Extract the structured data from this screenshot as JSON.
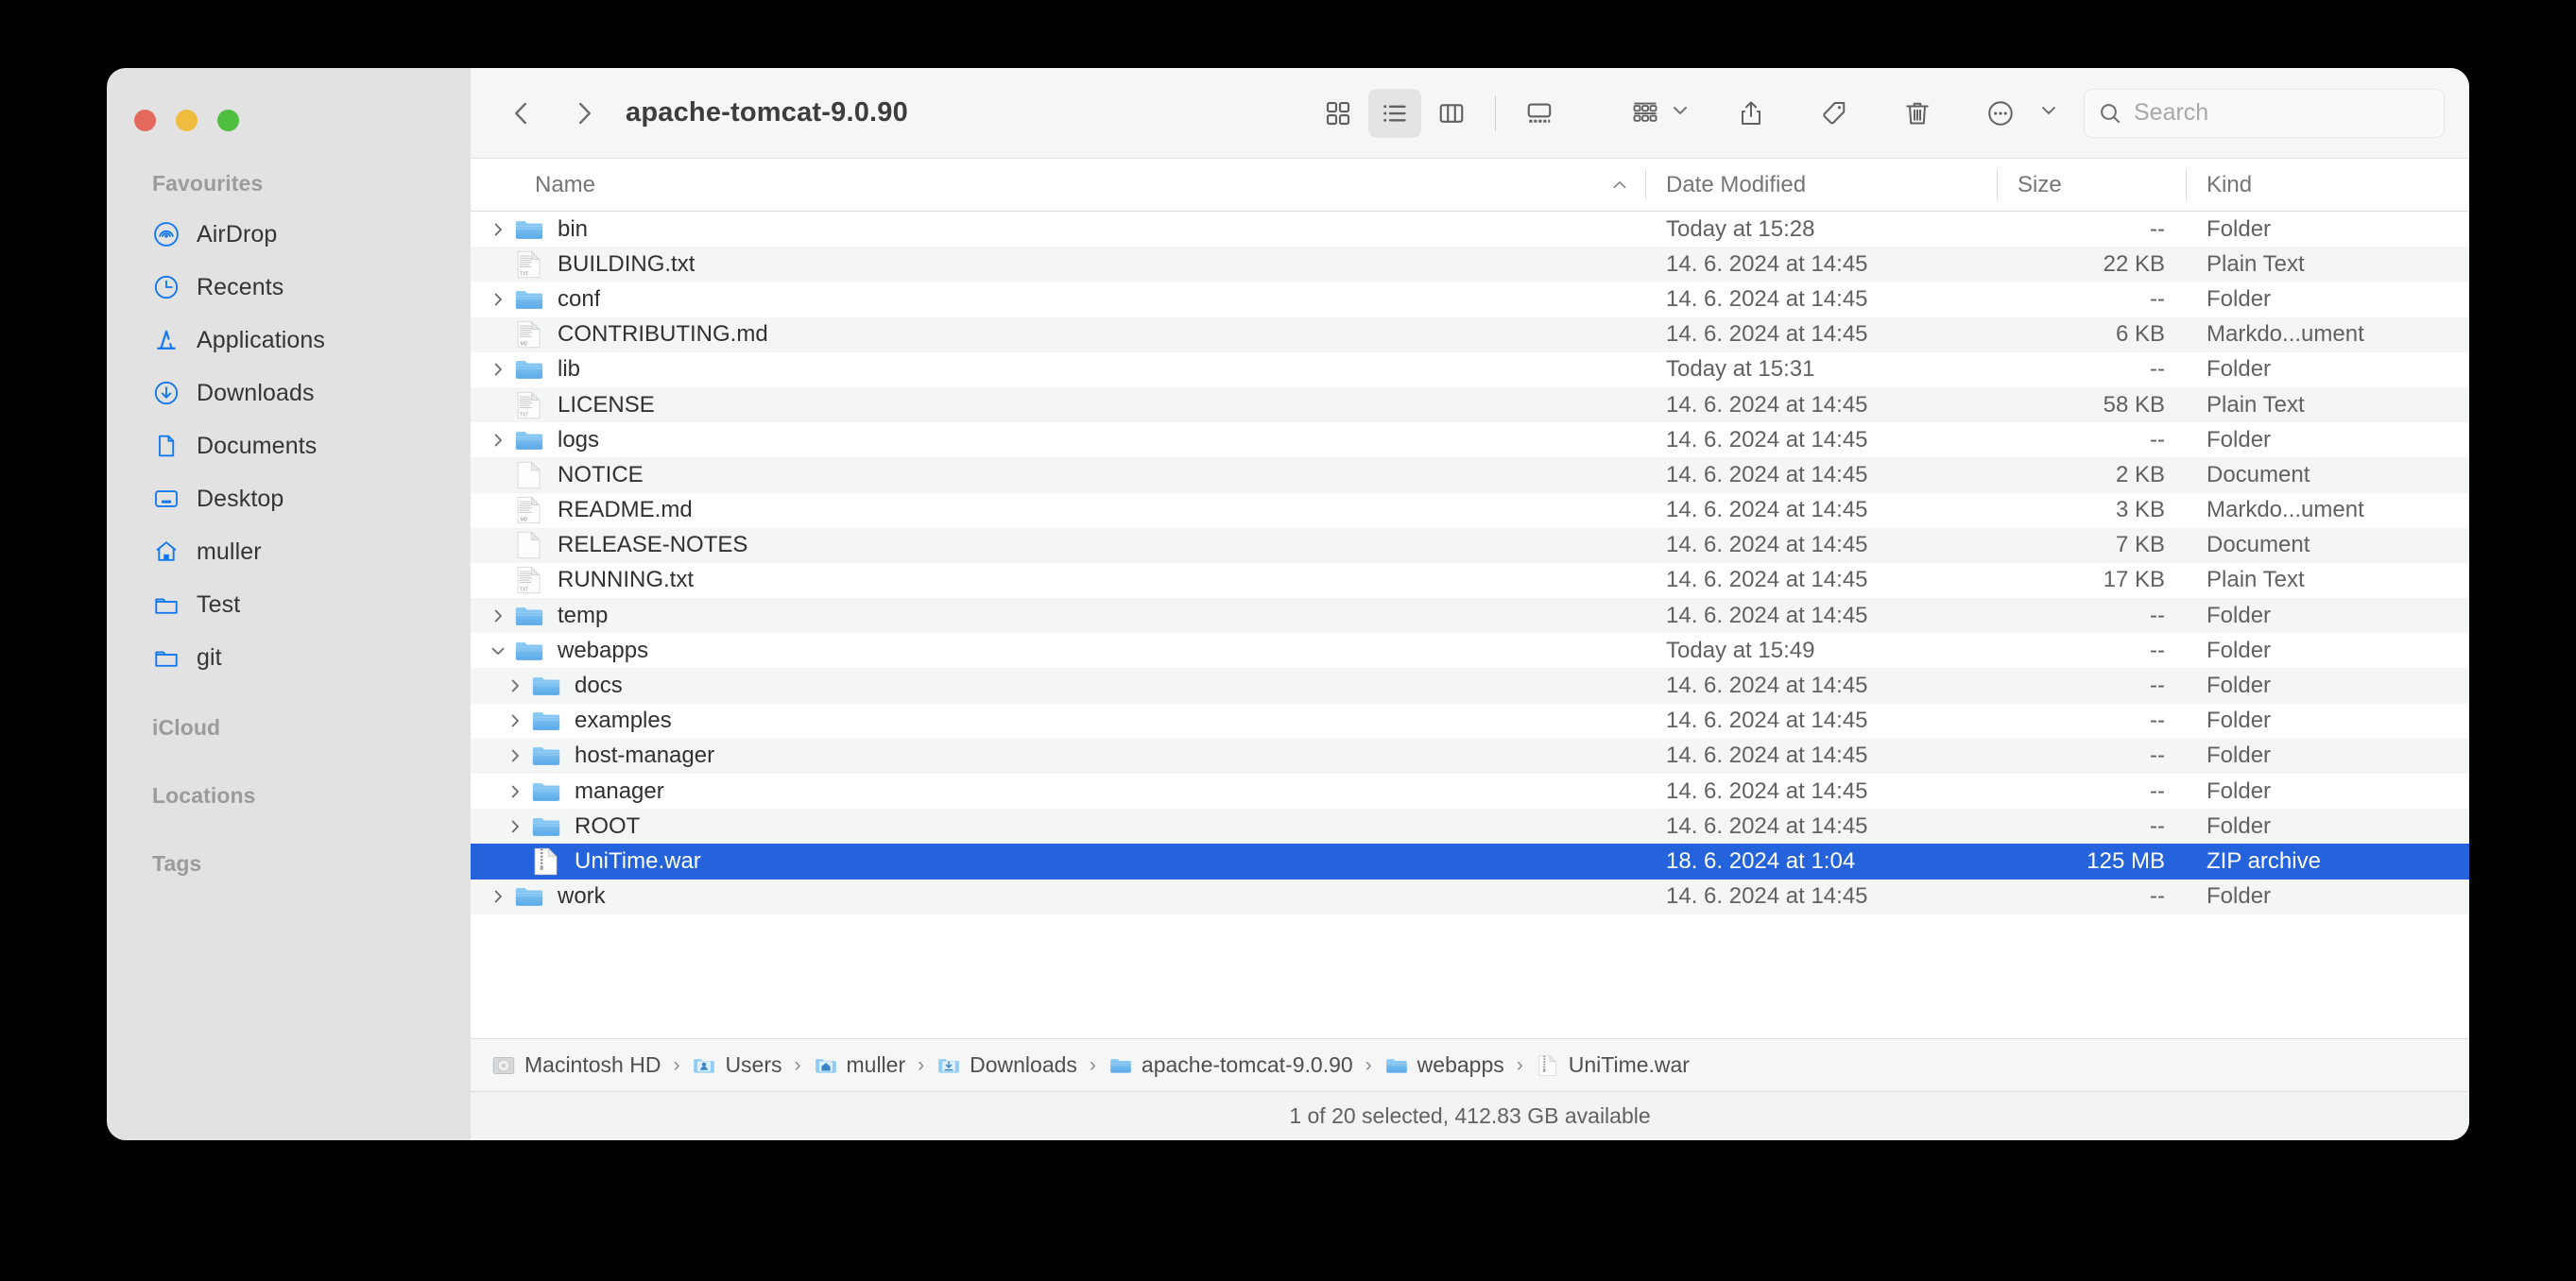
{
  "window": {
    "title": "apache-tomcat-9.0.90",
    "traffic_lights": [
      "close",
      "minimize",
      "zoom"
    ]
  },
  "sidebar": {
    "sections": [
      {
        "header": "Favourites",
        "items": [
          {
            "label": "AirDrop",
            "icon": "airdrop-icon"
          },
          {
            "label": "Recents",
            "icon": "clock-icon"
          },
          {
            "label": "Applications",
            "icon": "applications-icon"
          },
          {
            "label": "Downloads",
            "icon": "downloads-icon"
          },
          {
            "label": "Documents",
            "icon": "document-icon"
          },
          {
            "label": "Desktop",
            "icon": "desktop-icon"
          },
          {
            "label": "muller",
            "icon": "home-icon"
          },
          {
            "label": "Test",
            "icon": "folder-icon"
          },
          {
            "label": "git",
            "icon": "folder-icon"
          }
        ]
      },
      {
        "header": "iCloud",
        "items": []
      },
      {
        "header": "Locations",
        "items": []
      },
      {
        "header": "Tags",
        "items": []
      }
    ]
  },
  "toolbar": {
    "back_label": "Back",
    "forward_label": "Forward",
    "view_icon_grid": "icon-view-icon",
    "view_list": "list-view-icon",
    "view_column": "column-view-icon",
    "view_gallery": "gallery-view-icon",
    "active_view": "list-view-icon",
    "group_label": "Group",
    "share_label": "Share",
    "tag_label": "Tags",
    "delete_label": "Delete",
    "more_label": "More"
  },
  "search": {
    "placeholder": "Search",
    "value": "",
    "icon": "search-icon"
  },
  "columns": {
    "name": "Name",
    "date_modified": "Date Modified",
    "size": "Size",
    "kind": "Kind",
    "sort_direction": "ascending"
  },
  "files": [
    {
      "name": "bin",
      "date": "Today at 15:28",
      "size": "--",
      "kind": "Folder",
      "type": "folder",
      "expandable": true,
      "expanded": false,
      "indent": 0
    },
    {
      "name": "BUILDING.txt",
      "date": "14. 6. 2024 at 14:45",
      "size": "22 KB",
      "kind": "Plain Text",
      "type": "txt",
      "expandable": false,
      "expanded": false,
      "indent": 0
    },
    {
      "name": "conf",
      "date": "14. 6. 2024 at 14:45",
      "size": "--",
      "kind": "Folder",
      "type": "folder",
      "expandable": true,
      "expanded": false,
      "indent": 0
    },
    {
      "name": "CONTRIBUTING.md",
      "date": "14. 6. 2024 at 14:45",
      "size": "6 KB",
      "kind": "Markdo...ument",
      "type": "md",
      "expandable": false,
      "expanded": false,
      "indent": 0
    },
    {
      "name": "lib",
      "date": "Today at 15:31",
      "size": "--",
      "kind": "Folder",
      "type": "folder",
      "expandable": true,
      "expanded": false,
      "indent": 0
    },
    {
      "name": "LICENSE",
      "date": "14. 6. 2024 at 14:45",
      "size": "58 KB",
      "kind": "Plain Text",
      "type": "txt",
      "expandable": false,
      "expanded": false,
      "indent": 0
    },
    {
      "name": "logs",
      "date": "14. 6. 2024 at 14:45",
      "size": "--",
      "kind": "Folder",
      "type": "folder",
      "expandable": true,
      "expanded": false,
      "indent": 0
    },
    {
      "name": "NOTICE",
      "date": "14. 6. 2024 at 14:45",
      "size": "2 KB",
      "kind": "Document",
      "type": "blank",
      "expandable": false,
      "expanded": false,
      "indent": 0
    },
    {
      "name": "README.md",
      "date": "14. 6. 2024 at 14:45",
      "size": "3 KB",
      "kind": "Markdo...ument",
      "type": "md",
      "expandable": false,
      "expanded": false,
      "indent": 0
    },
    {
      "name": "RELEASE-NOTES",
      "date": "14. 6. 2024 at 14:45",
      "size": "7 KB",
      "kind": "Document",
      "type": "blank",
      "expandable": false,
      "expanded": false,
      "indent": 0
    },
    {
      "name": "RUNNING.txt",
      "date": "14. 6. 2024 at 14:45",
      "size": "17 KB",
      "kind": "Plain Text",
      "type": "txt",
      "expandable": false,
      "expanded": false,
      "indent": 0
    },
    {
      "name": "temp",
      "date": "14. 6. 2024 at 14:45",
      "size": "--",
      "kind": "Folder",
      "type": "folder",
      "expandable": true,
      "expanded": false,
      "indent": 0
    },
    {
      "name": "webapps",
      "date": "Today at 15:49",
      "size": "--",
      "kind": "Folder",
      "type": "folder",
      "expandable": true,
      "expanded": true,
      "indent": 0
    },
    {
      "name": "docs",
      "date": "14. 6. 2024 at 14:45",
      "size": "--",
      "kind": "Folder",
      "type": "folder",
      "expandable": true,
      "expanded": false,
      "indent": 1
    },
    {
      "name": "examples",
      "date": "14. 6. 2024 at 14:45",
      "size": "--",
      "kind": "Folder",
      "type": "folder",
      "expandable": true,
      "expanded": false,
      "indent": 1
    },
    {
      "name": "host-manager",
      "date": "14. 6. 2024 at 14:45",
      "size": "--",
      "kind": "Folder",
      "type": "folder",
      "expandable": true,
      "expanded": false,
      "indent": 1
    },
    {
      "name": "manager",
      "date": "14. 6. 2024 at 14:45",
      "size": "--",
      "kind": "Folder",
      "type": "folder",
      "expandable": true,
      "expanded": false,
      "indent": 1
    },
    {
      "name": "ROOT",
      "date": "14. 6. 2024 at 14:45",
      "size": "--",
      "kind": "Folder",
      "type": "folder",
      "expandable": true,
      "expanded": false,
      "indent": 1
    },
    {
      "name": "UniTime.war",
      "date": "18. 6. 2024 at 1:04",
      "size": "125 MB",
      "kind": "ZIP archive",
      "type": "war",
      "expandable": false,
      "expanded": false,
      "indent": 1,
      "selected": true
    },
    {
      "name": "work",
      "date": "14. 6. 2024 at 14:45",
      "size": "--",
      "kind": "Folder",
      "type": "folder",
      "expandable": true,
      "expanded": false,
      "indent": 0
    }
  ],
  "path_bar": [
    {
      "label": "Macintosh HD",
      "icon": "harddisk-icon"
    },
    {
      "label": "Users",
      "icon": "users-folder-icon"
    },
    {
      "label": "muller",
      "icon": "home-folder-icon"
    },
    {
      "label": "Downloads",
      "icon": "downloads-folder-icon"
    },
    {
      "label": "apache-tomcat-9.0.90",
      "icon": "folder-icon"
    },
    {
      "label": "webapps",
      "icon": "folder-icon"
    },
    {
      "label": "UniTime.war",
      "icon": "war-file-icon"
    }
  ],
  "status_bar": {
    "text": "1 of 20 selected, 412.83 GB available"
  },
  "colors": {
    "selection_blue": "#2563dd",
    "sidebar_icon_blue": "#1378f0",
    "sidebar_bg": "#e2e2e2",
    "toolbar_bg": "#f6f6f6",
    "row_alt": "#f4f5f5"
  }
}
